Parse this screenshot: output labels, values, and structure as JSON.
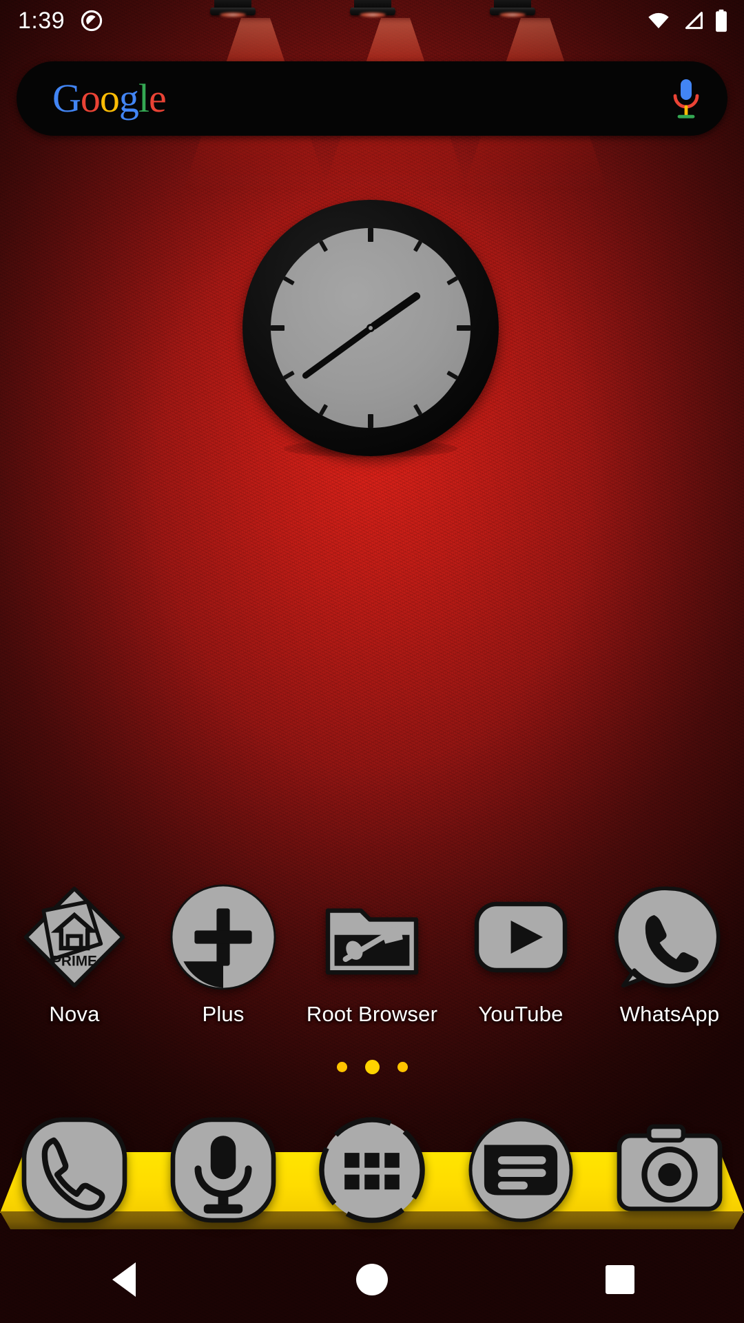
{
  "screen": {
    "type": "android-home-screen",
    "background_theme": "red-textured-wall-with-spotlights",
    "accent_color": "#FFD400",
    "wall_color": "#9c1512",
    "shelf_color": "#FFE500",
    "shelf_edge_color": "#7a5c05"
  },
  "status_bar": {
    "time": "1:39",
    "left_icons": [
      {
        "name": "do-not-disturb-icon",
        "glyph": "dnd"
      }
    ],
    "right_icons": [
      {
        "name": "wifi-icon",
        "glyph": "wifi"
      },
      {
        "name": "cellular-signal-icon",
        "glyph": "signal"
      },
      {
        "name": "battery-icon",
        "glyph": "battery-full"
      }
    ]
  },
  "search_bar": {
    "brand": "Google",
    "brand_letters": [
      {
        "char": "G",
        "color": "#4285F4"
      },
      {
        "char": "o",
        "color": "#EA4335"
      },
      {
        "char": "o",
        "color": "#FBBC05"
      },
      {
        "char": "g",
        "color": "#4285F4"
      },
      {
        "char": "l",
        "color": "#34A853"
      },
      {
        "char": "e",
        "color": "#EA4335"
      }
    ],
    "placeholder": "",
    "value": "",
    "mic_icon": "microphone-icon",
    "background_color": "#050505"
  },
  "clock_widget": {
    "style": "analog",
    "displayed_time": "1:39",
    "hour_angle_deg": 55,
    "minute_angle_deg": 234,
    "face_color": "#9a9a9a",
    "bezel_color": "#0a0a0a",
    "hand_color": "#0a0a0a",
    "tick_count": 12
  },
  "app_row": {
    "apps": [
      {
        "label": "Nova",
        "icon": "nova-launcher-prime-icon",
        "badge_text": "PRIME"
      },
      {
        "label": "Plus",
        "icon": "plus-add-icon",
        "badge_text": ""
      },
      {
        "label": "Root Browser",
        "icon": "root-browser-folder-icon",
        "badge_text": ""
      },
      {
        "label": "YouTube",
        "icon": "youtube-play-icon",
        "badge_text": ""
      },
      {
        "label": "WhatsApp",
        "icon": "whatsapp-phone-icon",
        "badge_text": ""
      }
    ]
  },
  "page_indicator": {
    "total_pages": 3,
    "current_page": 2,
    "dot_color": "#FFC400",
    "active_dot_color": "#FFD400"
  },
  "dock": {
    "items": [
      {
        "label": "Phone",
        "icon": "phone-handset-icon"
      },
      {
        "label": "Voice Search",
        "icon": "microphone-icon"
      },
      {
        "label": "App Drawer",
        "icon": "app-drawer-grid-icon"
      },
      {
        "label": "Messages",
        "icon": "messages-bubble-icon"
      },
      {
        "label": "Camera",
        "icon": "camera-icon"
      }
    ]
  },
  "nav_bar": {
    "buttons": [
      {
        "label": "Back",
        "icon": "back-triangle-icon"
      },
      {
        "label": "Home",
        "icon": "home-circle-icon"
      },
      {
        "label": "Recents",
        "icon": "recents-square-icon"
      }
    ]
  }
}
